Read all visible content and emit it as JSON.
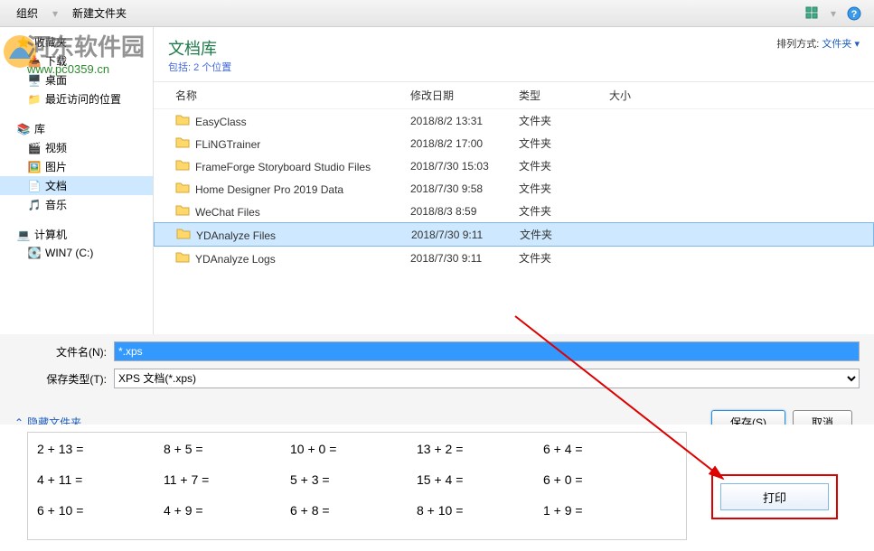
{
  "watermark": {
    "title": "河东软件园",
    "url": "www.pc0359.cn"
  },
  "toolbar": {
    "organize": "组织",
    "new_folder": "新建文件夹"
  },
  "sidebar": {
    "favorites": "收藏夹",
    "downloads": "下载",
    "desktop": "桌面",
    "recent": "最近访问的位置",
    "library": "库",
    "videos": "视频",
    "pictures": "图片",
    "documents": "文档",
    "music": "音乐",
    "computer": "计算机",
    "drive_c": "WIN7 (C:)"
  },
  "content": {
    "lib_title": "文档库",
    "lib_sub_prefix": "包括:",
    "lib_sub": "2 个位置",
    "sort_label": "排列方式:",
    "sort_value": "文件夹",
    "columns": {
      "name": "名称",
      "date": "修改日期",
      "type": "类型",
      "size": "大小"
    },
    "rows": [
      {
        "name": "EasyClass",
        "date": "2018/8/2 13:31",
        "type": "文件夹"
      },
      {
        "name": "FLiNGTrainer",
        "date": "2018/8/2 17:00",
        "type": "文件夹"
      },
      {
        "name": "FrameForge Storyboard Studio Files",
        "date": "2018/7/30 15:03",
        "type": "文件夹"
      },
      {
        "name": "Home Designer Pro 2019 Data",
        "date": "2018/7/30 9:58",
        "type": "文件夹"
      },
      {
        "name": "WeChat Files",
        "date": "2018/8/3 8:59",
        "type": "文件夹"
      },
      {
        "name": "YDAnalyze Files",
        "date": "2018/7/30 9:11",
        "type": "文件夹",
        "selected": true
      },
      {
        "name": "YDAnalyze Logs",
        "date": "2018/7/30 9:11",
        "type": "文件夹"
      }
    ]
  },
  "fields": {
    "filename_label": "文件名(N):",
    "filename_value": "*.xps",
    "filetype_label": "保存类型(T):",
    "filetype_value": "XPS 文档(*.xps)"
  },
  "actions": {
    "hide_folders": "隐藏文件夹",
    "save": "保存(S)",
    "cancel": "取消"
  },
  "math": {
    "rows": [
      [
        "2 + 13 =",
        "8 +  5 =",
        "10 +  0 =",
        "13 +  2 =",
        "6 +  4 ="
      ],
      [
        "4 + 11 =",
        "11 +  7 =",
        "5 +  3 =",
        "15 +  4 =",
        "6 +  0 ="
      ],
      [
        "6 + 10 =",
        "4 +  9 =",
        "6 +  8 =",
        "8 + 10 =",
        "1 +  9 ="
      ]
    ]
  },
  "print_label": "打印"
}
